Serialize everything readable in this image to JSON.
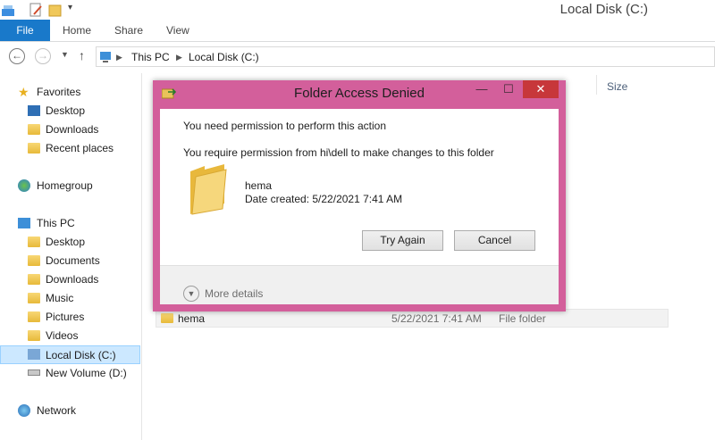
{
  "window": {
    "title": "Local Disk (C:)"
  },
  "ribbon": {
    "tabs": [
      {
        "label": "File"
      },
      {
        "label": "Home"
      },
      {
        "label": "Share"
      },
      {
        "label": "View"
      }
    ]
  },
  "address": {
    "back_icon": "arrow-left-icon",
    "forward_icon": "arrow-right-icon",
    "up_icon": "arrow-up-icon",
    "crumbs": [
      "This PC",
      "Local Disk (C:)"
    ]
  },
  "sidebar": {
    "favorites": {
      "label": "Favorites",
      "items": [
        "Desktop",
        "Downloads",
        "Recent places"
      ]
    },
    "homegroup": {
      "label": "Homegroup"
    },
    "thispc": {
      "label": "This PC",
      "items": [
        "Desktop",
        "Documents",
        "Downloads",
        "Music",
        "Pictures",
        "Videos",
        "Local Disk (C:)",
        "New Volume (D:)"
      ],
      "selected": "Local Disk (C:)"
    },
    "network": {
      "label": "Network"
    }
  },
  "columns": {
    "size": "Size"
  },
  "files": [
    {
      "name": "hema",
      "date": "5/22/2021 7:41 AM",
      "type": "File folder"
    }
  ],
  "dialog": {
    "title": "Folder Access Denied",
    "message": "You need permission to perform this action",
    "permission": "You require permission from hi\\dell to make changes to this folder",
    "item_name": "hema",
    "item_date": "Date created: 5/22/2021 7:41 AM",
    "try_again": "Try Again",
    "cancel": "Cancel",
    "more_details": "More details",
    "minimize_glyph": "—",
    "maximize_glyph": "☐",
    "close_glyph": "✕",
    "frame_color": "#d35f9b",
    "close_color": "#c7373a"
  },
  "colors": {
    "file_tab": "#1979ca",
    "selection": "#cce8ff"
  }
}
